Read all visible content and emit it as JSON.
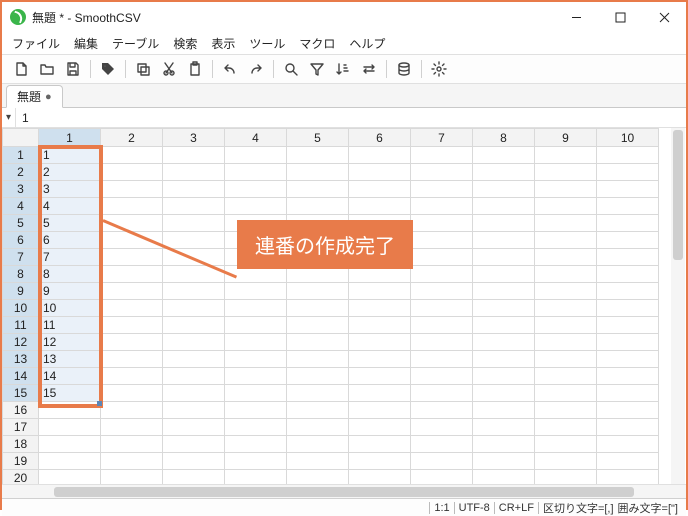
{
  "window": {
    "title": "無題 * - SmoothCSV"
  },
  "menu": {
    "items": [
      "ファイル",
      "編集",
      "テーブル",
      "検索",
      "表示",
      "ツール",
      "マクロ",
      "ヘルプ"
    ]
  },
  "tab": {
    "label": "無題",
    "modified": "●"
  },
  "formula": {
    "value": "1"
  },
  "columns": [
    "1",
    "2",
    "3",
    "4",
    "5",
    "6",
    "7",
    "8",
    "9",
    "10"
  ],
  "rows": [
    {
      "n": "1",
      "v": "1"
    },
    {
      "n": "2",
      "v": "2"
    },
    {
      "n": "3",
      "v": "3"
    },
    {
      "n": "4",
      "v": "4"
    },
    {
      "n": "5",
      "v": "5"
    },
    {
      "n": "6",
      "v": "6"
    },
    {
      "n": "7",
      "v": "7"
    },
    {
      "n": "8",
      "v": "8"
    },
    {
      "n": "9",
      "v": "9"
    },
    {
      "n": "10",
      "v": "10"
    },
    {
      "n": "11",
      "v": "11"
    },
    {
      "n": "12",
      "v": "12"
    },
    {
      "n": "13",
      "v": "13"
    },
    {
      "n": "14",
      "v": "14"
    },
    {
      "n": "15",
      "v": "15"
    },
    {
      "n": "16",
      "v": ""
    },
    {
      "n": "17",
      "v": ""
    },
    {
      "n": "18",
      "v": ""
    },
    {
      "n": "19",
      "v": ""
    },
    {
      "n": "20",
      "v": ""
    }
  ],
  "selection": {
    "col": 1,
    "rowStart": 1,
    "rowEnd": 15
  },
  "annotation": {
    "text": "連番の作成完了"
  },
  "status": {
    "pos": "1:1",
    "enc": "UTF-8",
    "nl": "CR+LF",
    "delim": "区切り文字=[,]",
    "quote": "囲み文字=[\"]"
  },
  "icons": {
    "new": "new-file-icon",
    "open": "open-folder-icon",
    "save": "save-icon",
    "tag": "tag-icon",
    "copy": "copy-icon",
    "cut": "cut-icon",
    "paste": "paste-icon",
    "undo": "undo-icon",
    "redo": "redo-icon",
    "search": "search-icon",
    "filter": "filter-icon",
    "sort": "sort-icon",
    "swap": "swap-icon",
    "db": "database-icon",
    "settings": "gear-icon"
  }
}
